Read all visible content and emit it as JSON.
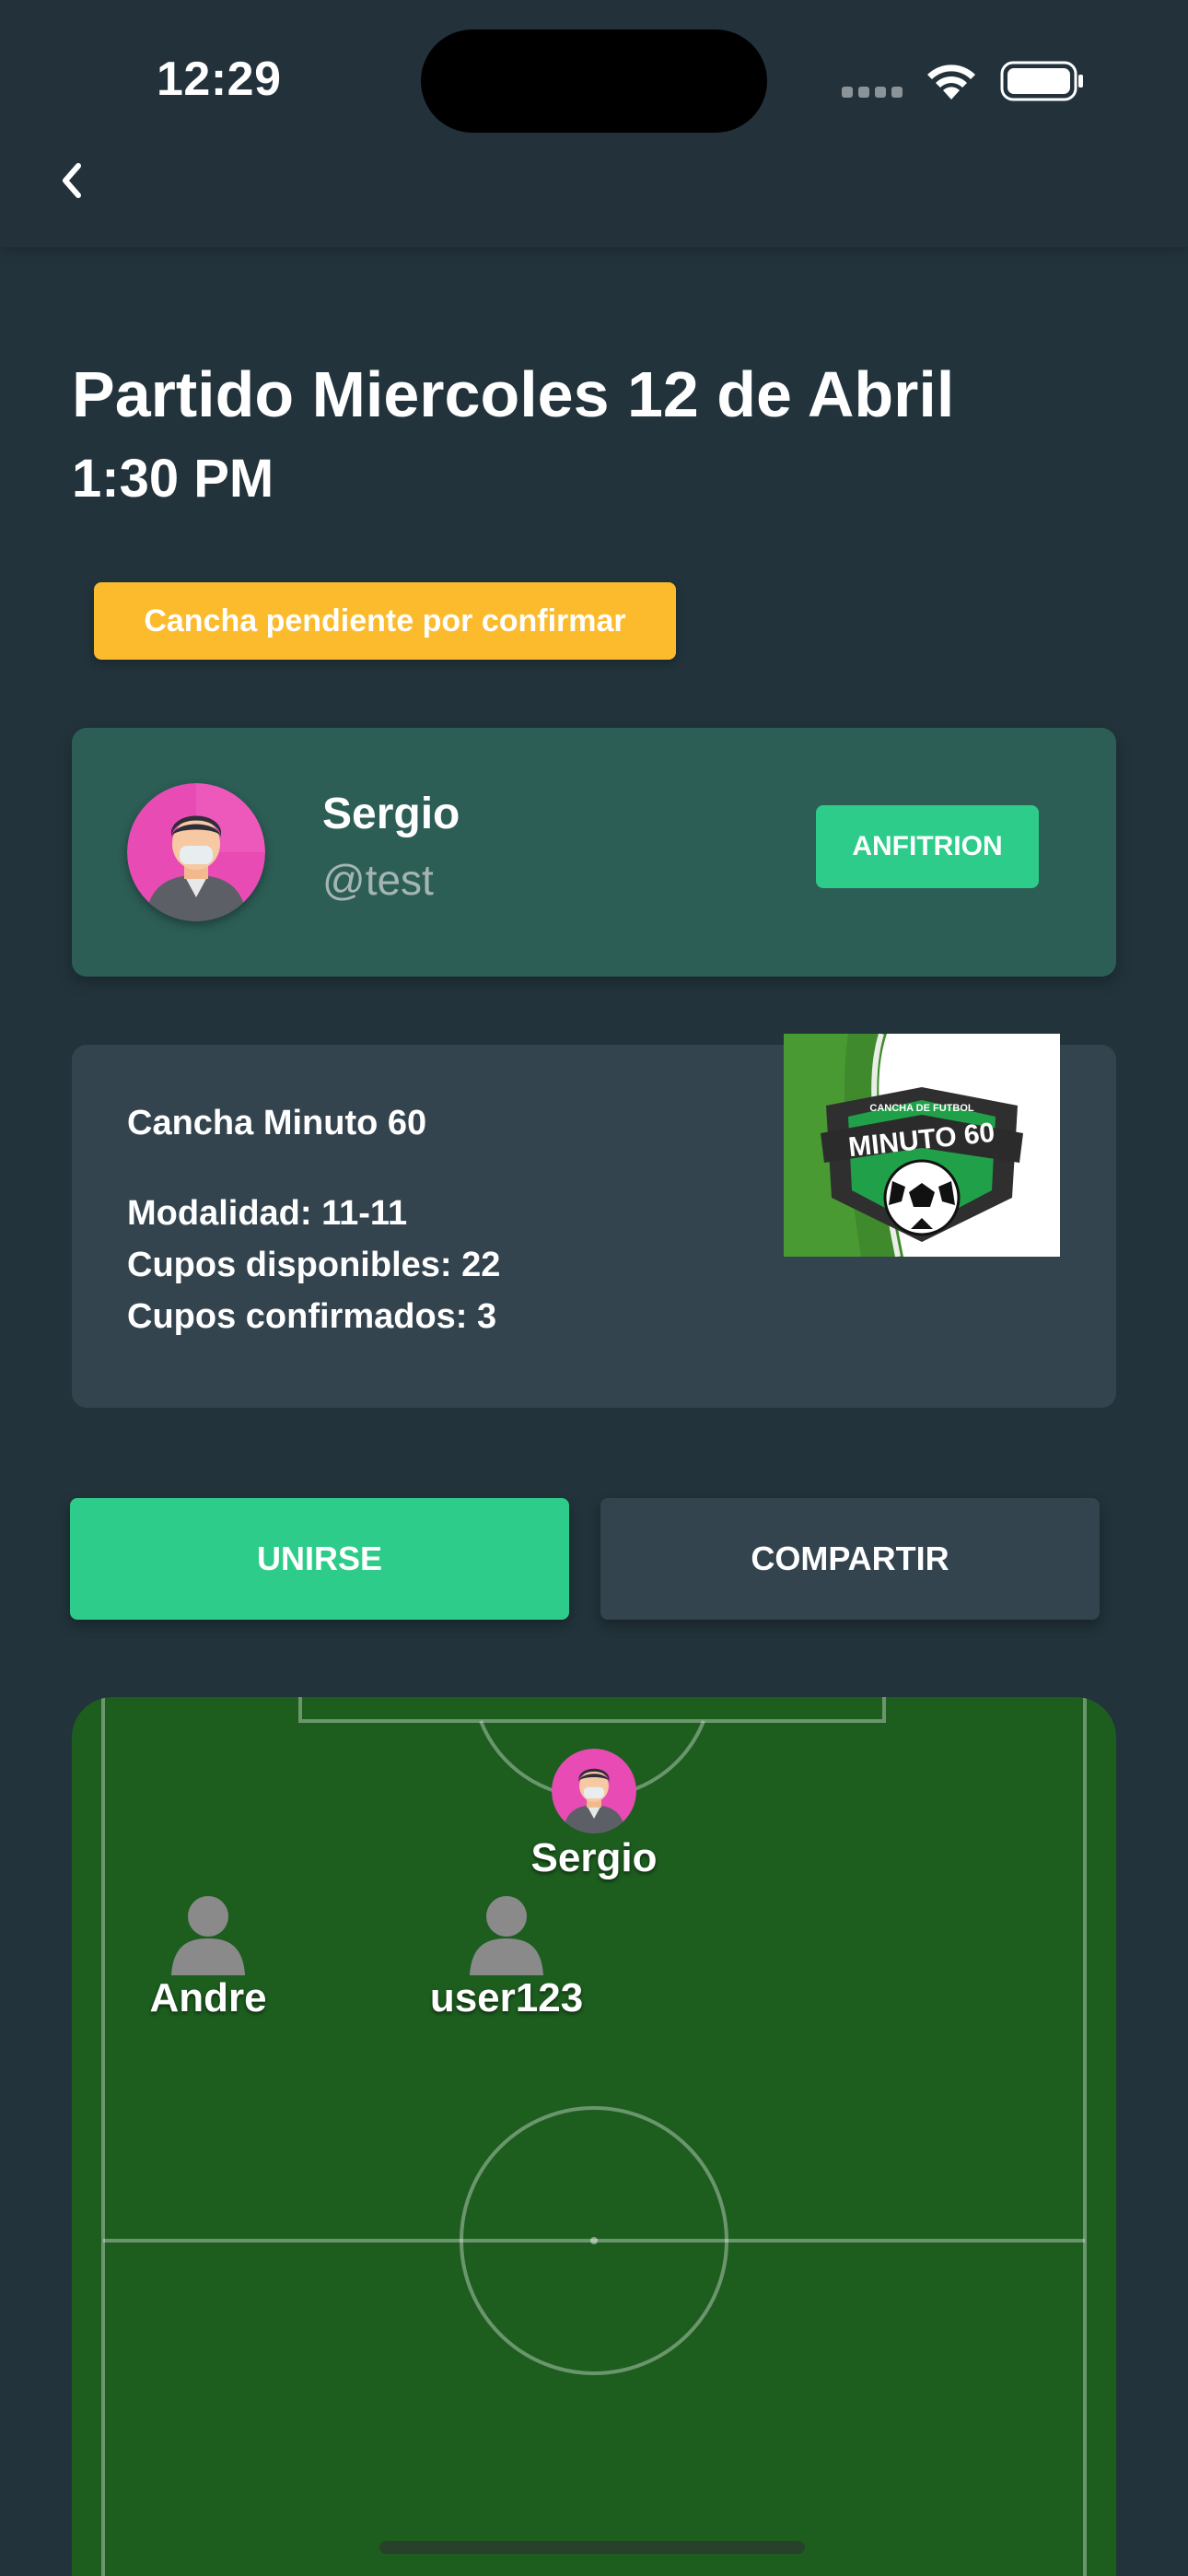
{
  "status_bar": {
    "time": "12:29"
  },
  "match": {
    "title": "Partido Miercoles 12 de Abril",
    "time": "1:30 PM",
    "status_badge": "Cancha pendiente por confirmar"
  },
  "host": {
    "name": "Sergio",
    "handle": "@test",
    "role": "ANFITRION"
  },
  "venue": {
    "name": "Cancha Minuto 60",
    "modality": "Modalidad: 11-11",
    "available_spots": "Cupos disponibles: 22",
    "confirmed_spots": "Cupos confirmados: 3",
    "logo": {
      "top_text": "CANCHA DE FUTBOL",
      "main_text": "MINUTO 60"
    }
  },
  "actions": {
    "join_label": "UNIRSE",
    "share_label": "COMPARTIR"
  },
  "lineup": {
    "players": [
      {
        "name": "Sergio",
        "avatar": "photo"
      },
      {
        "name": "Andre",
        "avatar": "placeholder"
      },
      {
        "name": "user123",
        "avatar": "placeholder"
      }
    ]
  },
  "colors": {
    "background": "#22333b",
    "accent": "#2ecc8a",
    "warning": "#fcbb2d",
    "host_card": "#2c5e56",
    "info_card": "#33444f",
    "pitch": "#1d5e1f"
  },
  "icons": {
    "back": "chevron-left-icon",
    "wifi": "wifi-icon",
    "battery": "battery-icon",
    "signal": "cellular-signal-icon"
  }
}
